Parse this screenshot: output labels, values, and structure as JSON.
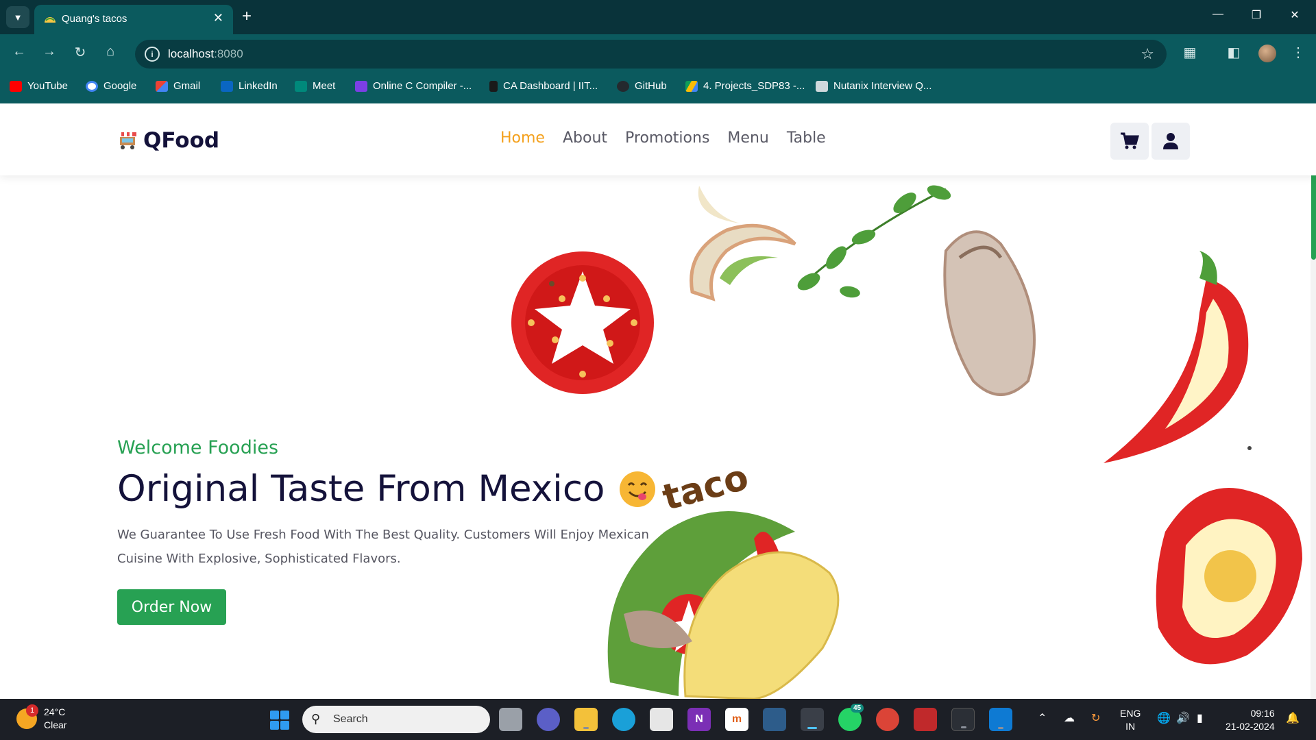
{
  "browser": {
    "tab_title": "Quang's tacos",
    "url_host": "localhost",
    "url_port": ":8080",
    "bookmarks": [
      {
        "label": "YouTube",
        "icon": "youtube-icon",
        "color": "#ff0000"
      },
      {
        "label": "Google",
        "icon": "google-icon",
        "color": "#4285f4"
      },
      {
        "label": "Gmail",
        "icon": "gmail-icon",
        "color": "#ea4335"
      },
      {
        "label": "LinkedIn",
        "icon": "linkedin-icon",
        "color": "#0a66c2"
      },
      {
        "label": "Meet",
        "icon": "meet-icon",
        "color": "#00897b"
      },
      {
        "label": "Online C Compiler -...",
        "icon": "compiler-icon",
        "color": "#7b3fe4"
      },
      {
        "label": "CA Dashboard | IIT...",
        "icon": "dashboard-icon",
        "color": "#1a1a1a"
      },
      {
        "label": "GitHub",
        "icon": "github-icon",
        "color": "#24292e"
      },
      {
        "label": "4. Projects_SDP83 -...",
        "icon": "drive-icon",
        "color": "#fbbc04"
      },
      {
        "label": "Nutanix Interview Q...",
        "icon": "interview-icon",
        "color": "#cfd8dc"
      }
    ]
  },
  "site": {
    "brand": "QFood",
    "nav": [
      {
        "label": "Home",
        "active": true
      },
      {
        "label": "About",
        "active": false
      },
      {
        "label": "Promotions",
        "active": false
      },
      {
        "label": "Menu",
        "active": false
      },
      {
        "label": "Table",
        "active": false
      }
    ],
    "hero": {
      "subtitle": "Welcome Foodies",
      "title": "Original Taste From Mexico",
      "description": "We Guarantee To Use Fresh Food With The Best Quality. Customers Will Enjoy Mexican Cuisine With Explosive, Sophisticated Flavors.",
      "cta": "Order Now",
      "illustration_text": "taco"
    },
    "colors": {
      "accent": "#f4a11d",
      "green": "#27a153",
      "navy": "#14123a"
    }
  },
  "taskbar": {
    "temperature": "24°C",
    "condition": "Clear",
    "weather_badge": "1",
    "search_label": "Search",
    "whatsapp_badge": "45",
    "lang_line1": "ENG",
    "lang_line2": "IN",
    "time": "09:16",
    "date": "21-02-2024"
  }
}
